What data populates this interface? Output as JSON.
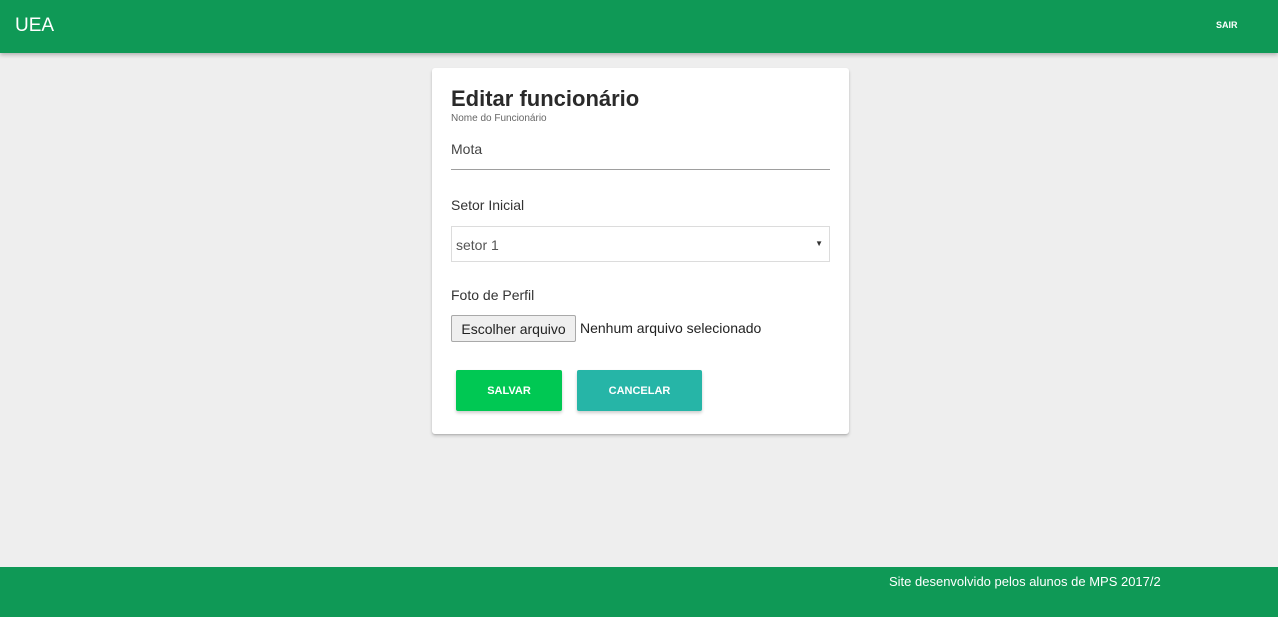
{
  "navbar": {
    "brand": "UEA",
    "logout_label": "SAIR"
  },
  "form": {
    "title": "Editar funcionário",
    "name_label": "Nome do Funcionário",
    "name_value": "Mota",
    "sector_label": "Setor Inicial",
    "sector_selected": "setor 1",
    "photo_label": "Foto de Perfil",
    "file_button_label": "Escolher arquivo",
    "file_status": "Nenhum arquivo selecionado",
    "save_label": "SALVAR",
    "cancel_label": "CANCELAR"
  },
  "footer": {
    "text": "Site desenvolvido pelos alunos de MPS 2017/2"
  },
  "colors": {
    "navbar": "#0f9956",
    "save_button": "#00c853",
    "cancel_button": "#26b5a7",
    "background": "#eeeeee"
  },
  "icons": {
    "select_caret": "caret-down-icon"
  }
}
